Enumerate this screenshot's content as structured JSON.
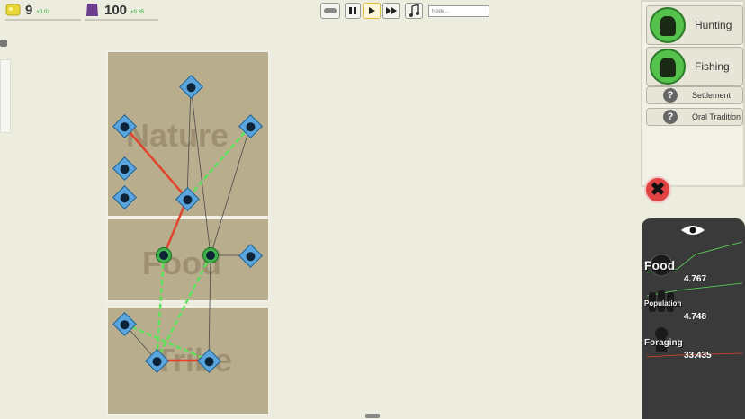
{
  "resources": [
    {
      "name": "knowledge",
      "value": "9",
      "delta": "+0.02",
      "icon": "lightbulb-icon",
      "color": "#e8d83a"
    },
    {
      "name": "population",
      "value": "100",
      "delta": "+0.35",
      "icon": "people-icon",
      "color": "#6b3e8f"
    }
  ],
  "controls": {
    "pause_icon": "pause-icon",
    "play_icon": "play-icon",
    "fast_forward_icon": "fast-forward-icon",
    "music_icon": "music-note-icon",
    "search_placeholder": "Node..."
  },
  "board": {
    "panels": [
      "Nature",
      "Food",
      "Tribe"
    ]
  },
  "tech_list": [
    {
      "label": "Hunting",
      "state": "unlocked",
      "icon": "hunter-deer-icon"
    },
    {
      "label": "Fishing",
      "state": "unlocked",
      "icon": "fisher-icon"
    },
    {
      "label": "Settlement",
      "state": "unknown",
      "icon": "question-icon"
    },
    {
      "label": "Oral Tradition",
      "state": "unknown",
      "icon": "question-icon"
    }
  ],
  "close_symbol": "✖",
  "stats": {
    "eye_icon": "eye-icon",
    "items": [
      {
        "name": "Food",
        "value": "4.767",
        "trend": "up"
      },
      {
        "name": "Population",
        "value": "4.748",
        "trend": "down"
      },
      {
        "name": "Foraging",
        "value": "33.435",
        "trend": "flat"
      }
    ]
  },
  "colors": {
    "positive_link": "#5fe05a",
    "negative_link": "#e0452e",
    "neutral_link": "#4a4a4a",
    "node_blue": "#5aa5de",
    "node_green": "#3fb34a"
  }
}
